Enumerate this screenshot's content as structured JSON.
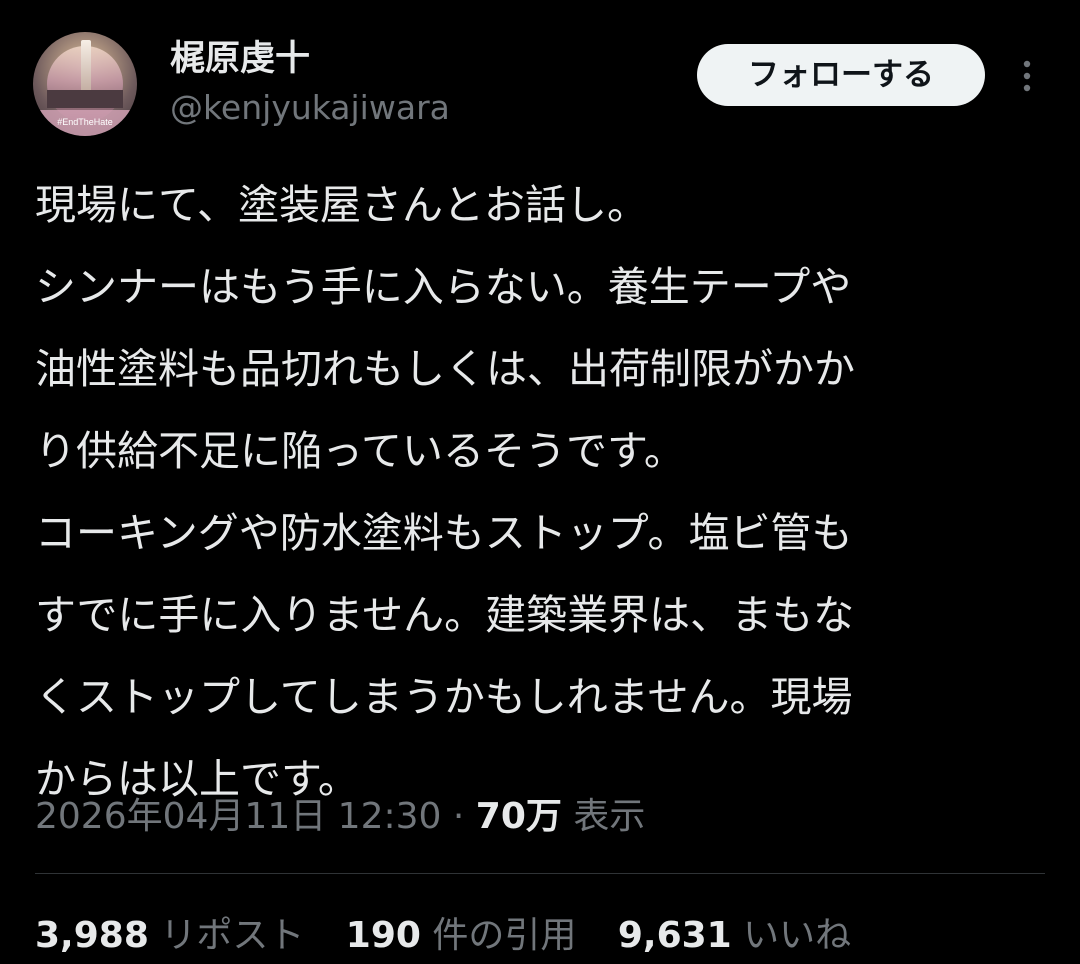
{
  "author": {
    "display_name": "梶原虔十",
    "handle": "@kenjyukajiwara",
    "avatar_banner_text": "#EndTheHate"
  },
  "actions": {
    "follow_label": "フォローする",
    "more_icon": "more-vertical-icon"
  },
  "tweet": {
    "lines": [
      "現場にて、塗装屋さんとお話し。",
      "シンナーはもう手に入らない。養生テープや",
      "油性塗料も品切れもしくは、出荷制限がかか",
      "り供給不足に陥っているそうです。",
      "コーキングや防水塗料もストップ。塩ビ管も",
      "すでに手に入りません。建築業界は、まもな",
      "くストップしてしまうかもしれません。現場",
      "からは以上です。"
    ],
    "timestamp": "2026年04月11日 12:30",
    "separator": " · ",
    "views_count": "70万",
    "views_label": " 表示"
  },
  "stats": {
    "reposts": {
      "count": "3,988",
      "label": " リポスト"
    },
    "quotes": {
      "count": "190",
      "label": " 件の引用"
    },
    "likes": {
      "count": "9,631",
      "label": " いいね"
    }
  },
  "colors": {
    "background": "#000000",
    "primary_text": "#e7e9ea",
    "secondary_text": "#71767b",
    "button_bg": "#eff3f4",
    "divider": "#2f3336"
  }
}
